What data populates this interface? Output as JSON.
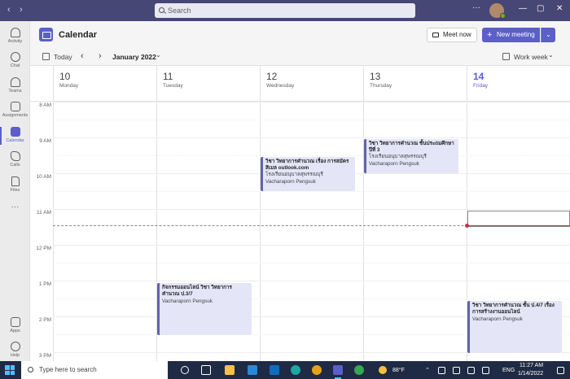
{
  "titlebar": {
    "back": "‹",
    "forward": "›",
    "search_placeholder": "Search",
    "more": "···",
    "minimize": "—",
    "maximize": "▢",
    "close": "✕"
  },
  "rail": {
    "items": [
      {
        "label": "Activity",
        "icon": "bell-icon"
      },
      {
        "label": "Chat",
        "icon": "chat-icon"
      },
      {
        "label": "Teams",
        "icon": "teams-icon"
      },
      {
        "label": "Assignments",
        "icon": "assignments-icon"
      },
      {
        "label": "Calendar",
        "icon": "calendar-icon"
      },
      {
        "label": "Calls",
        "icon": "phone-icon"
      },
      {
        "label": "Files",
        "icon": "file-icon"
      }
    ],
    "more": "···",
    "apps_label": "Apps",
    "help_label": "Help"
  },
  "header": {
    "title": "Calendar",
    "meet_now": "Meet now",
    "new_meeting": "New meeting"
  },
  "toolbar": {
    "today": "Today",
    "month": "January 2022",
    "view": "Work week"
  },
  "days": [
    {
      "num": "10",
      "name": "Monday"
    },
    {
      "num": "11",
      "name": "Tuesday"
    },
    {
      "num": "12",
      "name": "Wednesday"
    },
    {
      "num": "13",
      "name": "Thursday"
    },
    {
      "num": "14",
      "name": "Friday"
    }
  ],
  "times": [
    "8 AM",
    "9 AM",
    "10 AM",
    "11 AM",
    "12 PM",
    "1 PM",
    "2 PM",
    "3 PM"
  ],
  "events": [
    {
      "title": "วิชา วิทยาการคำนวณ เรื่อง การสมัคร สิเมล outlook.com",
      "location": "โรงเรียนอนุบาลสุพรรณบุรี",
      "organizer": "Vacharaporn Pengsuk"
    },
    {
      "title": "วิชา วิทยาการคำนวณ ชั้นประถมศึกษาปีที่ 3",
      "location": "โรงเรียนอนุบาลสุพรรณบุรี",
      "organizer": "Vacharaporn Pengsuk"
    },
    {
      "title": "กิจกรรมออนไลน์ วิชา วิทยาการคำนวณ ป.3/7",
      "location": "",
      "organizer": "Vacharaporn Pengsuk"
    },
    {
      "title": "วิชา วิทยาการคำนวณ ชั้น ป.4/7 เรื่อง การสร้างงานออนไลน์",
      "location": "",
      "organizer": "Vacharaporn Pengsuk"
    }
  ],
  "taskbar": {
    "search_placeholder": "Type here to search",
    "weather": "88°F",
    "lang": "ENG",
    "time": "11:27 AM",
    "date": "1/14/2022"
  }
}
